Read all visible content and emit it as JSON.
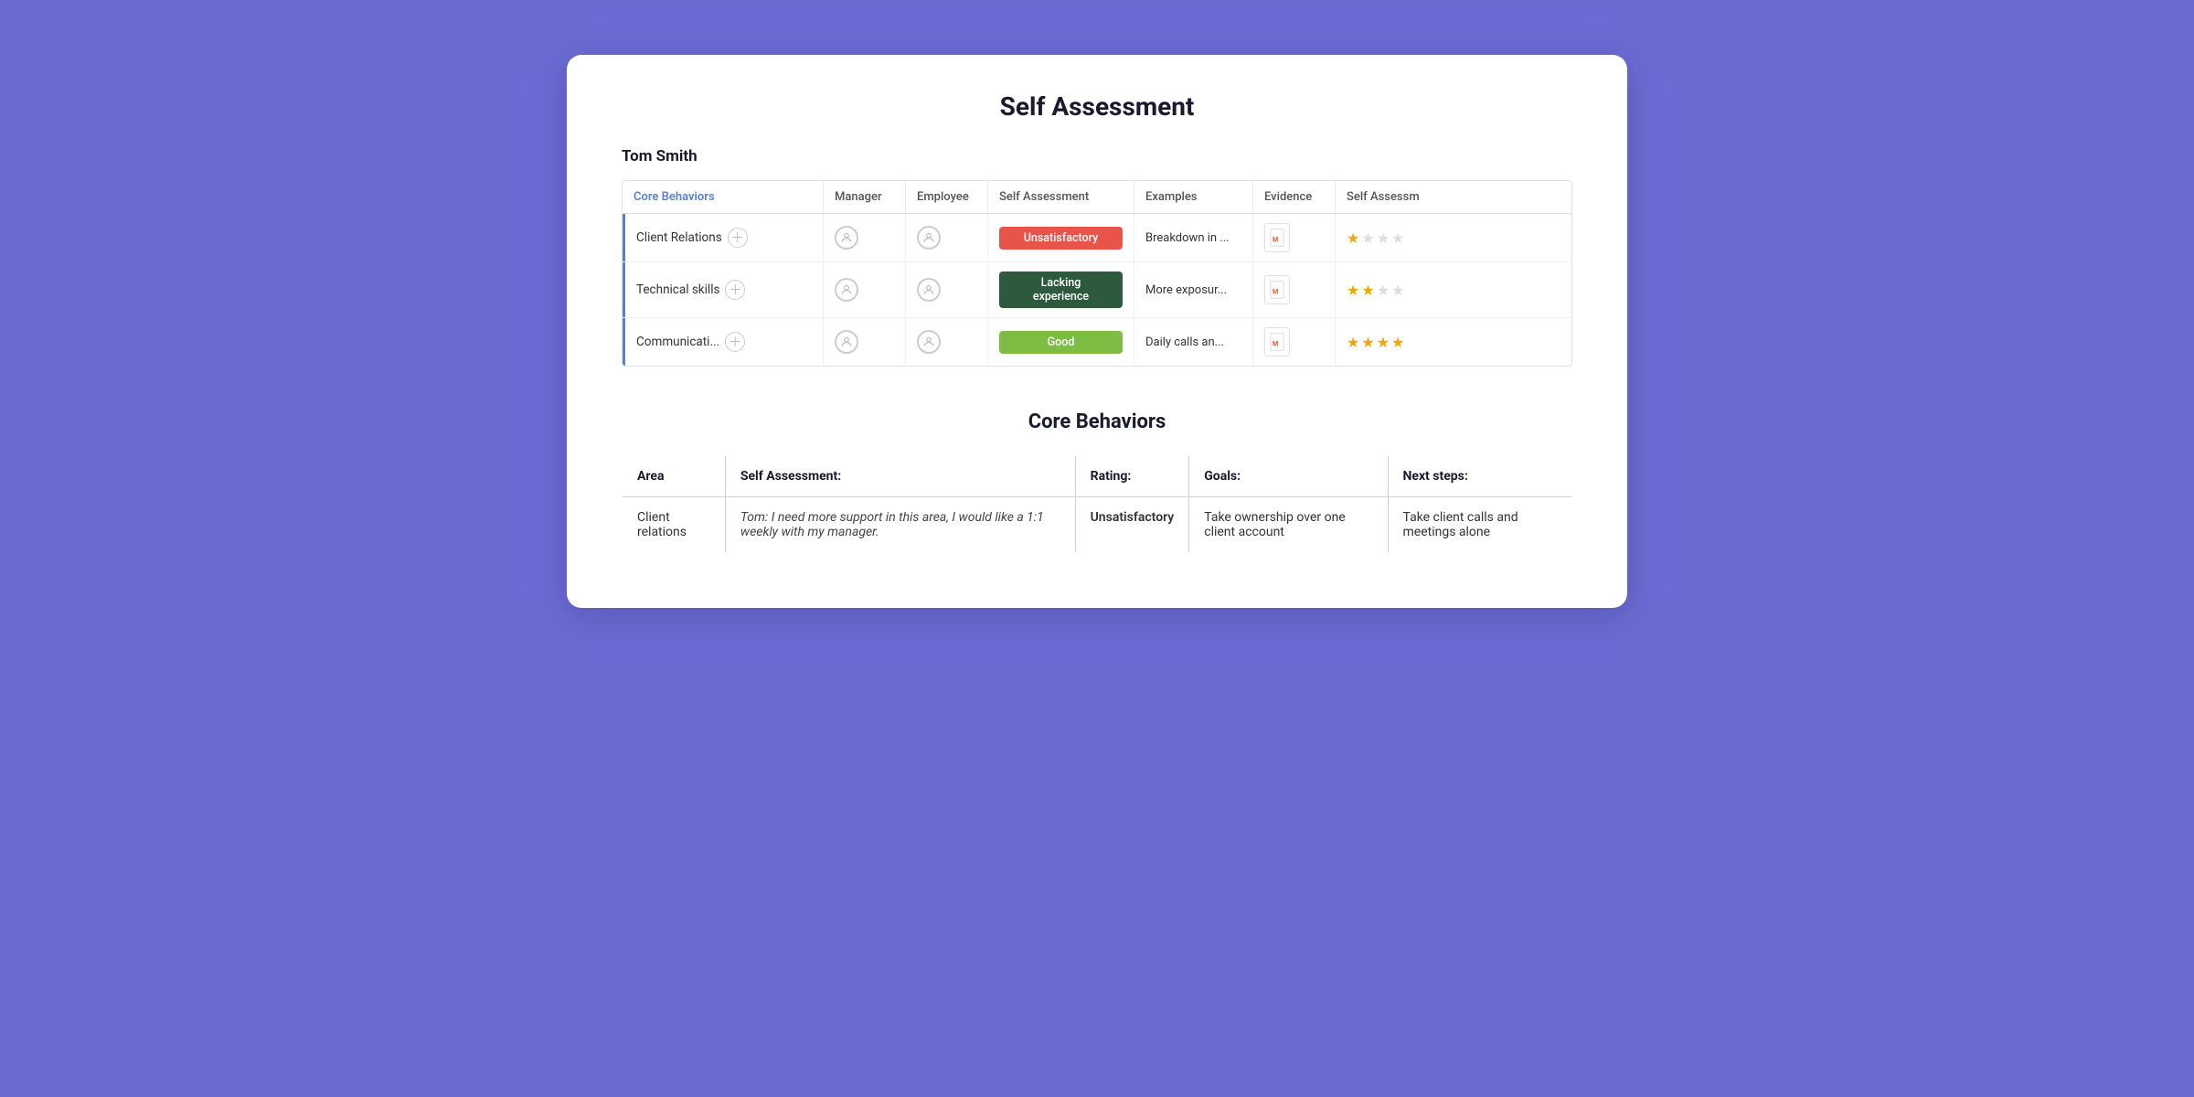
{
  "page": {
    "title": "Self Assessment",
    "employee_name": "Tom Smith"
  },
  "spreadsheet": {
    "headers": [
      "Core Behaviors",
      "Manager",
      "Employee",
      "Self Assessment",
      "Examples",
      "Evidence",
      "Self Assessm"
    ],
    "rows": [
      {
        "name": "Client Relations",
        "badge": "Unsatisfactory",
        "badge_class": "badge-unsatisfactory",
        "examples": "Breakdown in ...",
        "stars": [
          true,
          false,
          false,
          false
        ]
      },
      {
        "name": "Technical skills",
        "badge": "Lacking experience",
        "badge_class": "badge-lacking",
        "examples": "More exposur...",
        "stars": [
          true,
          true,
          false,
          false
        ]
      },
      {
        "name": "Communicati...",
        "badge": "Good",
        "badge_class": "badge-good",
        "examples": "Daily calls an...",
        "stars": [
          true,
          true,
          true,
          true
        ]
      }
    ]
  },
  "section": {
    "title": "Core Behaviors",
    "table_headers": {
      "area": "Area",
      "self_assessment": "Self Assessment:",
      "rating": "Rating:",
      "goals": "Goals:",
      "next_steps": "Next steps:"
    },
    "rows": [
      {
        "area": "Client relations",
        "self_assessment": "Tom: I need more support in this area, I would like a 1:1 weekly with my manager.",
        "rating": "Unsatisfactory",
        "rating_class": "rating-unsatisfactory",
        "goals": "Take ownership over one client account",
        "next_steps": "Take client calls and meetings alone"
      }
    ]
  }
}
